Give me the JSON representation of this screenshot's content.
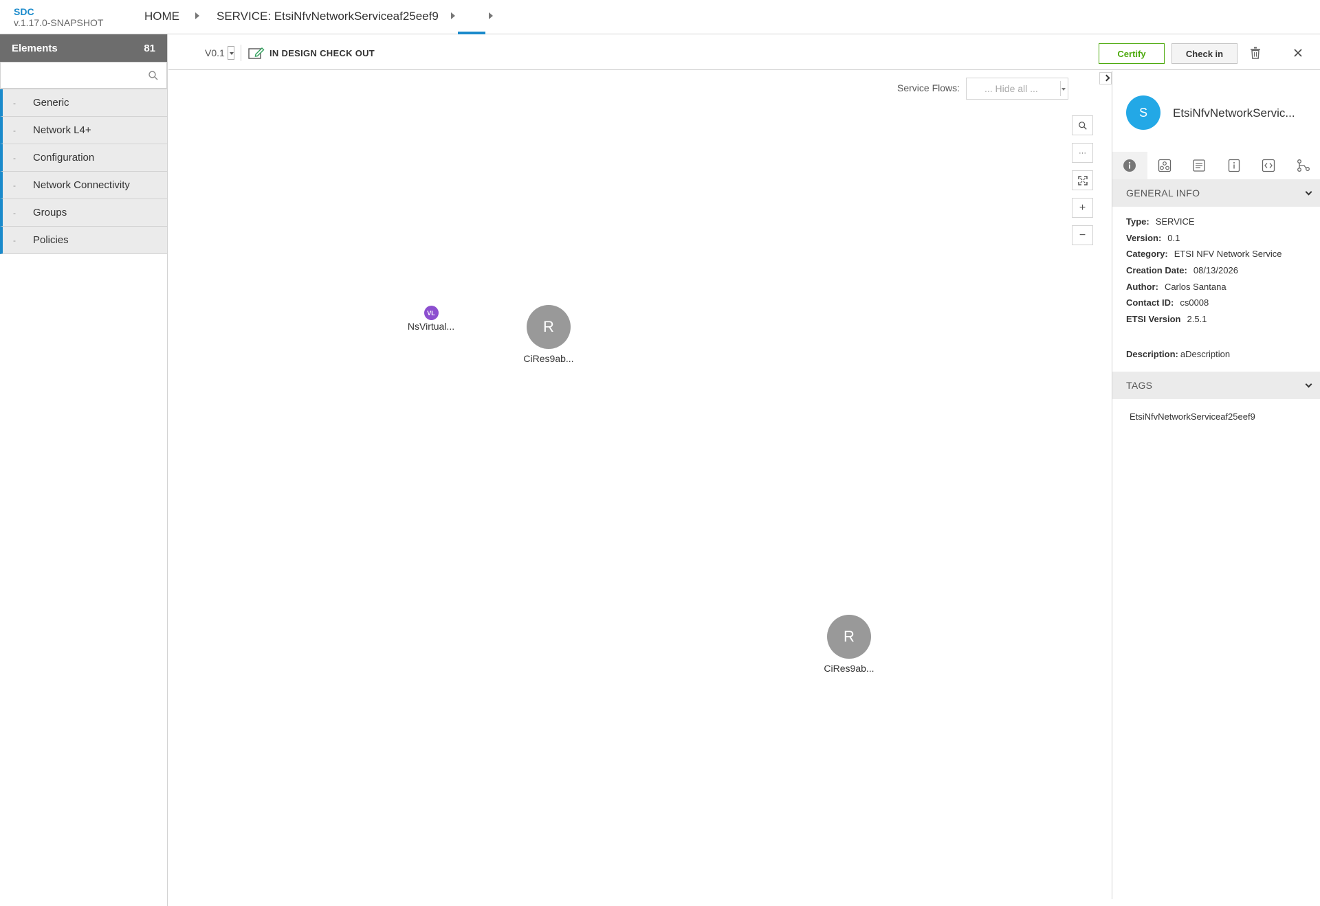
{
  "app": {
    "name": "SDC",
    "version": "v.1.17.0-SNAPSHOT"
  },
  "breadcrumb": {
    "home": "HOME",
    "service": "SERVICE: EtsiNfvNetworkServiceaf25eef9"
  },
  "palette": {
    "title": "Elements",
    "count": "81",
    "search_placeholder": "",
    "groups": [
      {
        "dash": "-",
        "label": "Generic"
      },
      {
        "dash": "-",
        "label": "Network L4+"
      },
      {
        "dash": "-",
        "label": "Configuration"
      },
      {
        "dash": "-",
        "label": "Network Connectivity"
      },
      {
        "dash": "-",
        "label": "Groups"
      },
      {
        "dash": "-",
        "label": "Policies"
      }
    ]
  },
  "toolbar": {
    "version": "V0.1",
    "status": "IN DESIGN CHECK OUT",
    "certify_label": "Certify",
    "checkin_label": "Check in"
  },
  "canvas": {
    "flows_label": "Service Flows:",
    "flows_value": "... Hide all ...",
    "zoom_more": "···",
    "zoom_in": "+",
    "zoom_out": "−",
    "nodes": [
      {
        "letter": "VL",
        "label": "NsVirtual..."
      },
      {
        "letter": "R",
        "label": "CiRes9ab..."
      },
      {
        "letter": "R",
        "label": "CiRes9ab..."
      }
    ]
  },
  "panel": {
    "avatar_letter": "S",
    "title": "EtsiNfvNetworkServic...",
    "general_info_title": "GENERAL INFO",
    "info": [
      {
        "key": "Type:",
        "value": "SERVICE"
      },
      {
        "key": "Version:",
        "value": "0.1"
      },
      {
        "key": "Category:",
        "value": "ETSI NFV Network Service"
      },
      {
        "key": "Creation Date:",
        "value": "08/13/2026"
      },
      {
        "key": "Author:",
        "value": "Carlos Santana"
      },
      {
        "key": "Contact ID:",
        "value": "cs0008"
      },
      {
        "key": "ETSI Version",
        "value": "2.5.1"
      }
    ],
    "description_key": "Description:",
    "description_value": "aDescription",
    "tags_title": "TAGS",
    "tags": [
      "EtsiNfvNetworkServiceaf25eef9"
    ]
  },
  "colors": {
    "accent": "#1a8acb",
    "certify": "#4ca90c",
    "vl_node": "#8c4fcf",
    "resource_node": "#999999",
    "service_avatar": "#23a8e6"
  }
}
